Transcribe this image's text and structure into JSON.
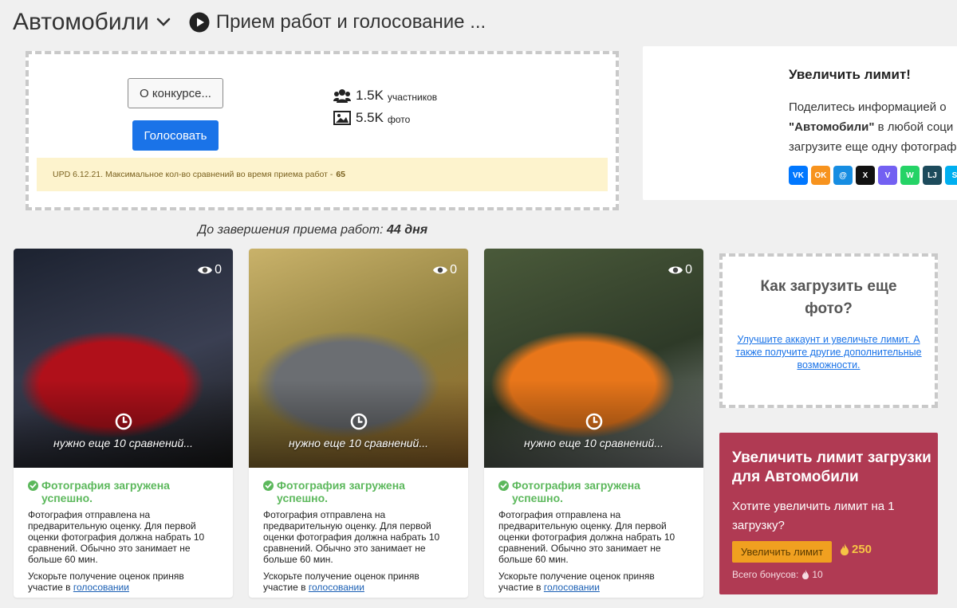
{
  "header": {
    "title": "Автомобили",
    "subtitle": "Прием работ и голосование ..."
  },
  "contest": {
    "about_button": "О конкурсе...",
    "vote_button": "Голосовать",
    "participants_value": "1.5K",
    "participants_label": "участников",
    "photos_value": "5.5K",
    "photos_label": "фото",
    "update_note": "UPD 6.12.21. Максимальное кол-во сравнений во время приема работ -",
    "update_value": "65"
  },
  "deadline": {
    "label": "До завершения приема работ:",
    "value": "44 дня"
  },
  "share": {
    "title": "Увеличить лимит!",
    "line1": "Поделитесь информацией о",
    "line2_quoted": "\"Автомобили\"",
    "line2_rest": " в любой соци",
    "line3": "загрузите еще одну фотограф",
    "networks": [
      {
        "icon": "vk-icon",
        "text": "VK",
        "color": "#0077ff"
      },
      {
        "icon": "odnoklassniki-icon",
        "text": "OK",
        "color": "#f7931e"
      },
      {
        "icon": "moimir-icon",
        "text": "@",
        "color": "#168de2"
      },
      {
        "icon": "x-icon",
        "text": "X",
        "color": "#111111"
      },
      {
        "icon": "viber-icon",
        "text": "V",
        "color": "#7360f2"
      },
      {
        "icon": "whatsapp-icon",
        "text": "W",
        "color": "#25d366"
      },
      {
        "icon": "livejournal-icon",
        "text": "LJ",
        "color": "#1d4b5c"
      },
      {
        "icon": "skype-icon",
        "text": "S",
        "color": "#00aff0"
      }
    ]
  },
  "cards": [
    {
      "views": "0",
      "need_more": "нужно еще 10 сравнений...",
      "status": "Фотография загружена успешно.",
      "message": "Фотография отправлена на предварительную оценку. Для первой оценки фотография должна набрать 10 сравнений. Обычно это занимает не больше 60 мин.",
      "speedup_text": "Ускорьте получение оценок приняв участие в",
      "speedup_link": "голосовании",
      "photo_colors": [
        "#1c2230",
        "#3a3f52",
        "#b0101a",
        "#1a1a1a"
      ]
    },
    {
      "views": "0",
      "need_more": "нужно еще 10 сравнений...",
      "status": "Фотография загружена успешно.",
      "message": "Фотография отправлена на предварительную оценку. Для первой оценки фотография должна набрать 10 сравнений. Обычно это занимает не больше 60 мин.",
      "speedup_text": "Ускорьте получение оценок приняв участие в",
      "speedup_link": "голосовании",
      "photo_colors": [
        "#c9b26a",
        "#8a7a3a",
        "#6b6e72",
        "#9a6a2a"
      ]
    },
    {
      "views": "0",
      "need_more": "нужно еще 10 сравнений...",
      "status": "Фотография загружена успешно.",
      "message": "Фотография отправлена на предварительную оценку. Для первой оценки фотография должна набрать 10 сравнений. Обычно это занимает не больше 60 мин.",
      "speedup_text": "Ускорьте получение оценок приняв участие в",
      "speedup_link": "голосовании",
      "photo_colors": [
        "#4a5a3a",
        "#2e3a28",
        "#e8761a",
        "#8a8f90"
      ]
    }
  ],
  "howto": {
    "title": "Как загрузить еще фото?",
    "link": "Улучшите аккаунт и увеличьте лимит. А также получите другие дополнительные возможности."
  },
  "promo": {
    "title": "Увеличить лимит загрузки для Автомобили",
    "text": "Хотите увеличить лимит на 1 загрузку?",
    "button": "Увеличить лимит",
    "price": "250",
    "bonus_label": "Всего бонусов:",
    "bonus_value": "10"
  },
  "colors": {
    "accent": "#1a73e8",
    "success": "#5cb85c",
    "promo_bg": "#b03a53",
    "promo_btn": "#f0a020",
    "note_bg": "#fdf3cd"
  }
}
